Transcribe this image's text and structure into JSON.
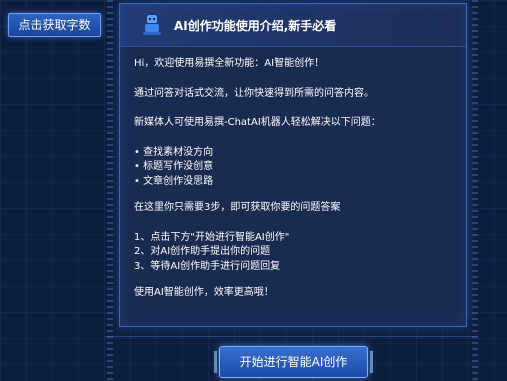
{
  "left_button": {
    "label": "点击获取字数"
  },
  "panel": {
    "header": {
      "title": "AI创作功能使用介绍,新手必看"
    },
    "intro": "Hi，欢迎使用易撰全新功能：AI智能创作！",
    "desc": "通过问答对话式交流，让你快速得到所需的问答内容。",
    "lead": "新媒体人可使用易撰-ChatAI机器人轻松解决以下问题：",
    "bullets": [
      "• 查找素材没方向",
      "• 标题写作没创意",
      "• 文章创作没思路"
    ],
    "steps_intro": "在这里你只需要3步，即可获取你要的问题答案",
    "steps": [
      "1、点击下方\"开始进行智能AI创作\"",
      "2、对AI创作助手提出你的问题",
      "3、等待AI创作助手进行问题回复"
    ],
    "closing": "使用AI智能创作，效率更高哦！"
  },
  "start_button": {
    "label": "开始进行智能AI创作"
  },
  "colors": {
    "background": "#0e1e3f",
    "panel": "#1a2b52",
    "accent": "#3d67c4",
    "button": "#2f64c2"
  },
  "icons": {
    "header": "robot-icon"
  }
}
